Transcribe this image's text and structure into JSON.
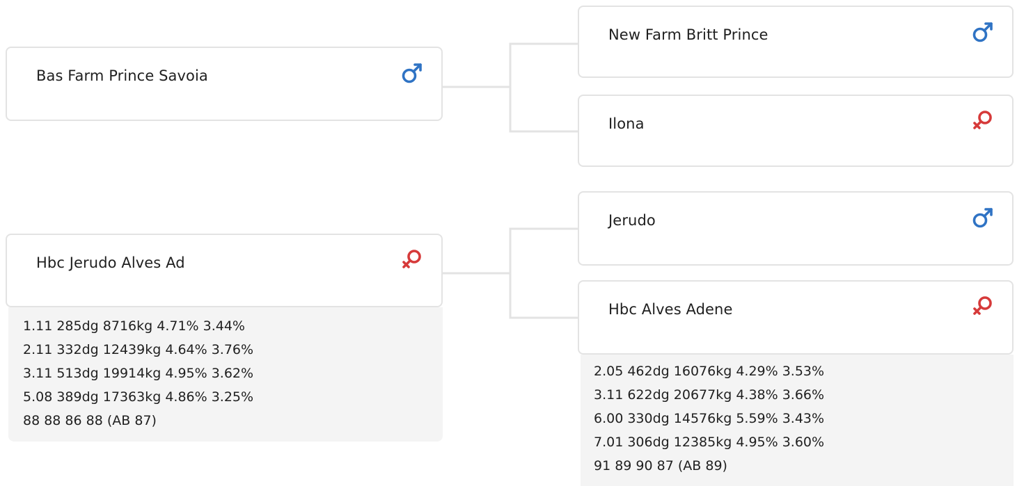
{
  "colors": {
    "male": "#2f73c4",
    "female": "#d63a3a",
    "border": "#e3e3e3",
    "stats_bg": "#f4f4f4",
    "connector": "#e3e3e3"
  },
  "pedigree": {
    "sire": {
      "name": "Bas Farm Prince Savoia",
      "sex": "male",
      "sex_icon": "male-icon",
      "sire": {
        "name": "New Farm Britt Prince",
        "sex": "male",
        "sex_icon": "male-icon"
      },
      "dam": {
        "name": "Ilona",
        "sex": "female",
        "sex_icon": "female-icon"
      }
    },
    "dam": {
      "name": "Hbc Jerudo Alves Ad",
      "sex": "female",
      "sex_icon": "female-icon",
      "stats": [
        "1.11 285dg 8716kg 4.71% 3.44%",
        "2.11 332dg 12439kg 4.64% 3.76%",
        "3.11 513dg 19914kg 4.95% 3.62%",
        "5.08 389dg 17363kg 4.86% 3.25%",
        "88 88 86 88 (AB 87)"
      ],
      "sire": {
        "name": "Jerudo",
        "sex": "male",
        "sex_icon": "male-icon"
      },
      "dam": {
        "name": "Hbc Alves Adene",
        "sex": "female",
        "sex_icon": "female-icon",
        "stats": [
          "2.05 462dg 16076kg 4.29% 3.53%",
          "3.11 622dg 20677kg 4.38% 3.66%",
          "6.00 330dg 14576kg 5.59% 3.43%",
          "7.01 306dg 12385kg 4.95% 3.60%",
          "91 89 90 87 (AB 89)"
        ]
      }
    }
  }
}
